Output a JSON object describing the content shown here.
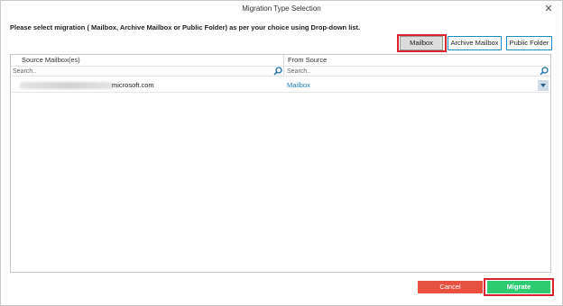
{
  "window": {
    "title": "Migration Type Selection",
    "close_glyph": "✕"
  },
  "instruction": "Please select migration ( Mailbox, Archive Mailbox or Public Folder) as per your choice using Drop-down list.",
  "migration_types": {
    "selected": "Mailbox",
    "options": [
      "Mailbox",
      "Archive Mailbox",
      "Public Folder"
    ]
  },
  "grid": {
    "columns": [
      "Source Mailbox(es)",
      "From Source"
    ],
    "search_placeholder": "Search..",
    "rows": [
      {
        "source_suffix": "microsoft.com",
        "from_source": "Mailbox"
      }
    ]
  },
  "footer": {
    "cancel_label": "Cancel",
    "migrate_label": "Migrate"
  },
  "colors": {
    "accent_blue": "#1e8bc3",
    "highlight_red": "#d9232e",
    "cancel_red": "#e8503f",
    "migrate_green": "#2ecc71",
    "link_blue": "#1a7fc0"
  },
  "icons": [
    "close-icon",
    "search-icon",
    "chevron-down-icon"
  ]
}
